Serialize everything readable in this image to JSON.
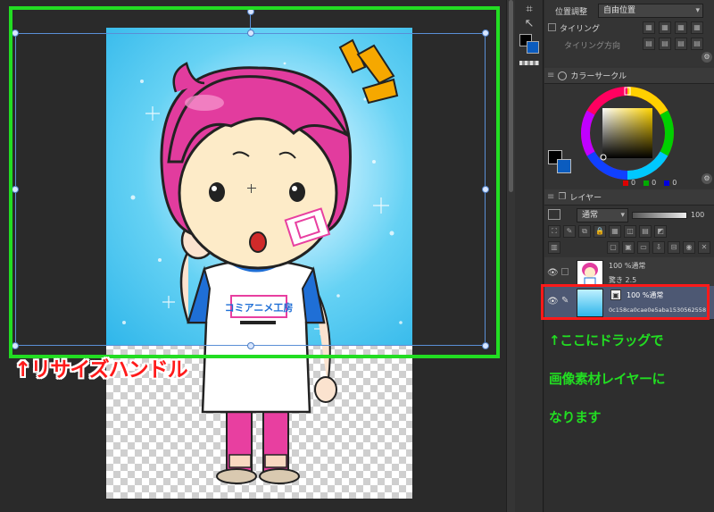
{
  "tool_property": {
    "position_label": "位置調整",
    "position_value": "自由位置",
    "tiling_label": "タイリング",
    "tiling_direction_label": "タイリング方向"
  },
  "color_wheel": {
    "title": "カラーサークル",
    "rgb": [
      "0",
      "0",
      "0"
    ]
  },
  "layer_panel": {
    "tab_label": "レイヤー",
    "blend_mode": "通常",
    "opacity_value": "100",
    "layers": [
      {
        "name_line1": "100 %通常",
        "name_line2": "驚き 2.5"
      },
      {
        "name_line1": "100 %通常",
        "name_line2": "0c158ca0cae0e5aba1530562558",
        "selected": true
      }
    ]
  },
  "annotations": {
    "resize_handle_caption": "↑リサイズハンドル",
    "drag_note_line1": "↑ここにドラッグで",
    "drag_note_line2": "画像素材レイヤーに",
    "drag_note_line3": "なります"
  },
  "artwork": {
    "shirt_logo": "コミアニメ工房"
  },
  "colors": {
    "highlight_green": "#22dd22",
    "highlight_red": "#ff1a1a",
    "selection_blue": "#5a8fd6"
  }
}
